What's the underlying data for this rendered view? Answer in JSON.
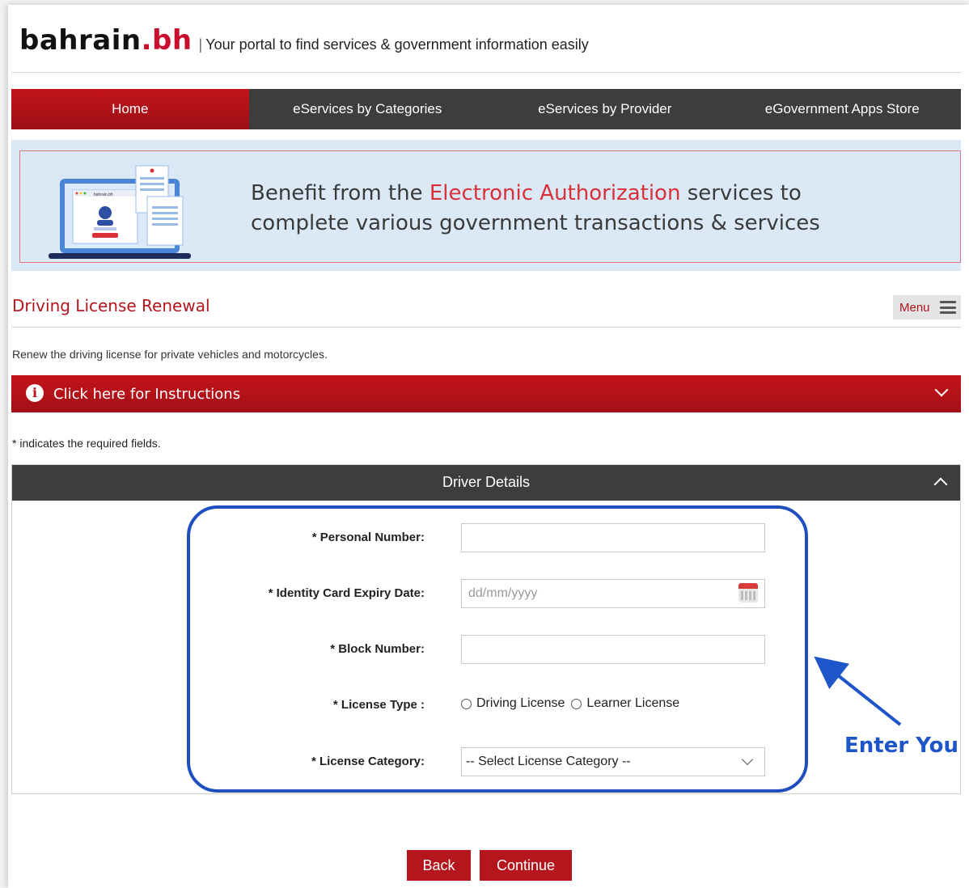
{
  "header": {
    "logo_main": "bahrain",
    "logo_dot": ".",
    "logo_tld": "bh",
    "separator": "|",
    "tagline": "Your portal to find services & government information easily"
  },
  "nav": {
    "items": [
      {
        "label": "Home",
        "active": true
      },
      {
        "label": "eServices by Categories",
        "active": false
      },
      {
        "label": "eServices by Provider",
        "active": false
      },
      {
        "label": "eGovernment Apps Store",
        "active": false
      }
    ]
  },
  "banner": {
    "text_pre": "Benefit from the ",
    "text_highlight": "Electronic Authorization",
    "text_post": " services to",
    "text_line2": "complete various government transactions & services",
    "mock_logo": "bahrain.bh"
  },
  "page": {
    "title": "Driving License Renewal",
    "menu_label": "Menu",
    "description": "Renew the driving license for private vehicles and motorcycles.",
    "instructions_label": "Click here for Instructions",
    "required_note": "* indicates the required fields."
  },
  "driver_details": {
    "heading": "Driver Details",
    "personal_number_label": "* Personal Number:",
    "personal_number_value": "",
    "id_expiry_label": "* Identity Card Expiry Date:",
    "id_expiry_placeholder": "dd/mm/yyyy",
    "block_number_label": "* Block Number:",
    "block_number_value": "",
    "license_type_label": "* License Type :",
    "license_type_options": [
      "Driving License",
      "Learner License"
    ],
    "license_category_label": "* License Category:",
    "license_category_selected": "-- Select License Category --"
  },
  "annotation": {
    "text": "Enter You",
    "color": "#1e55c8"
  },
  "buttons": {
    "back": "Back",
    "continue": "Continue"
  },
  "colors": {
    "brand_red": "#b5151c",
    "nav_dark": "#3d3d3d",
    "banner_bg": "#dbe8f5"
  }
}
